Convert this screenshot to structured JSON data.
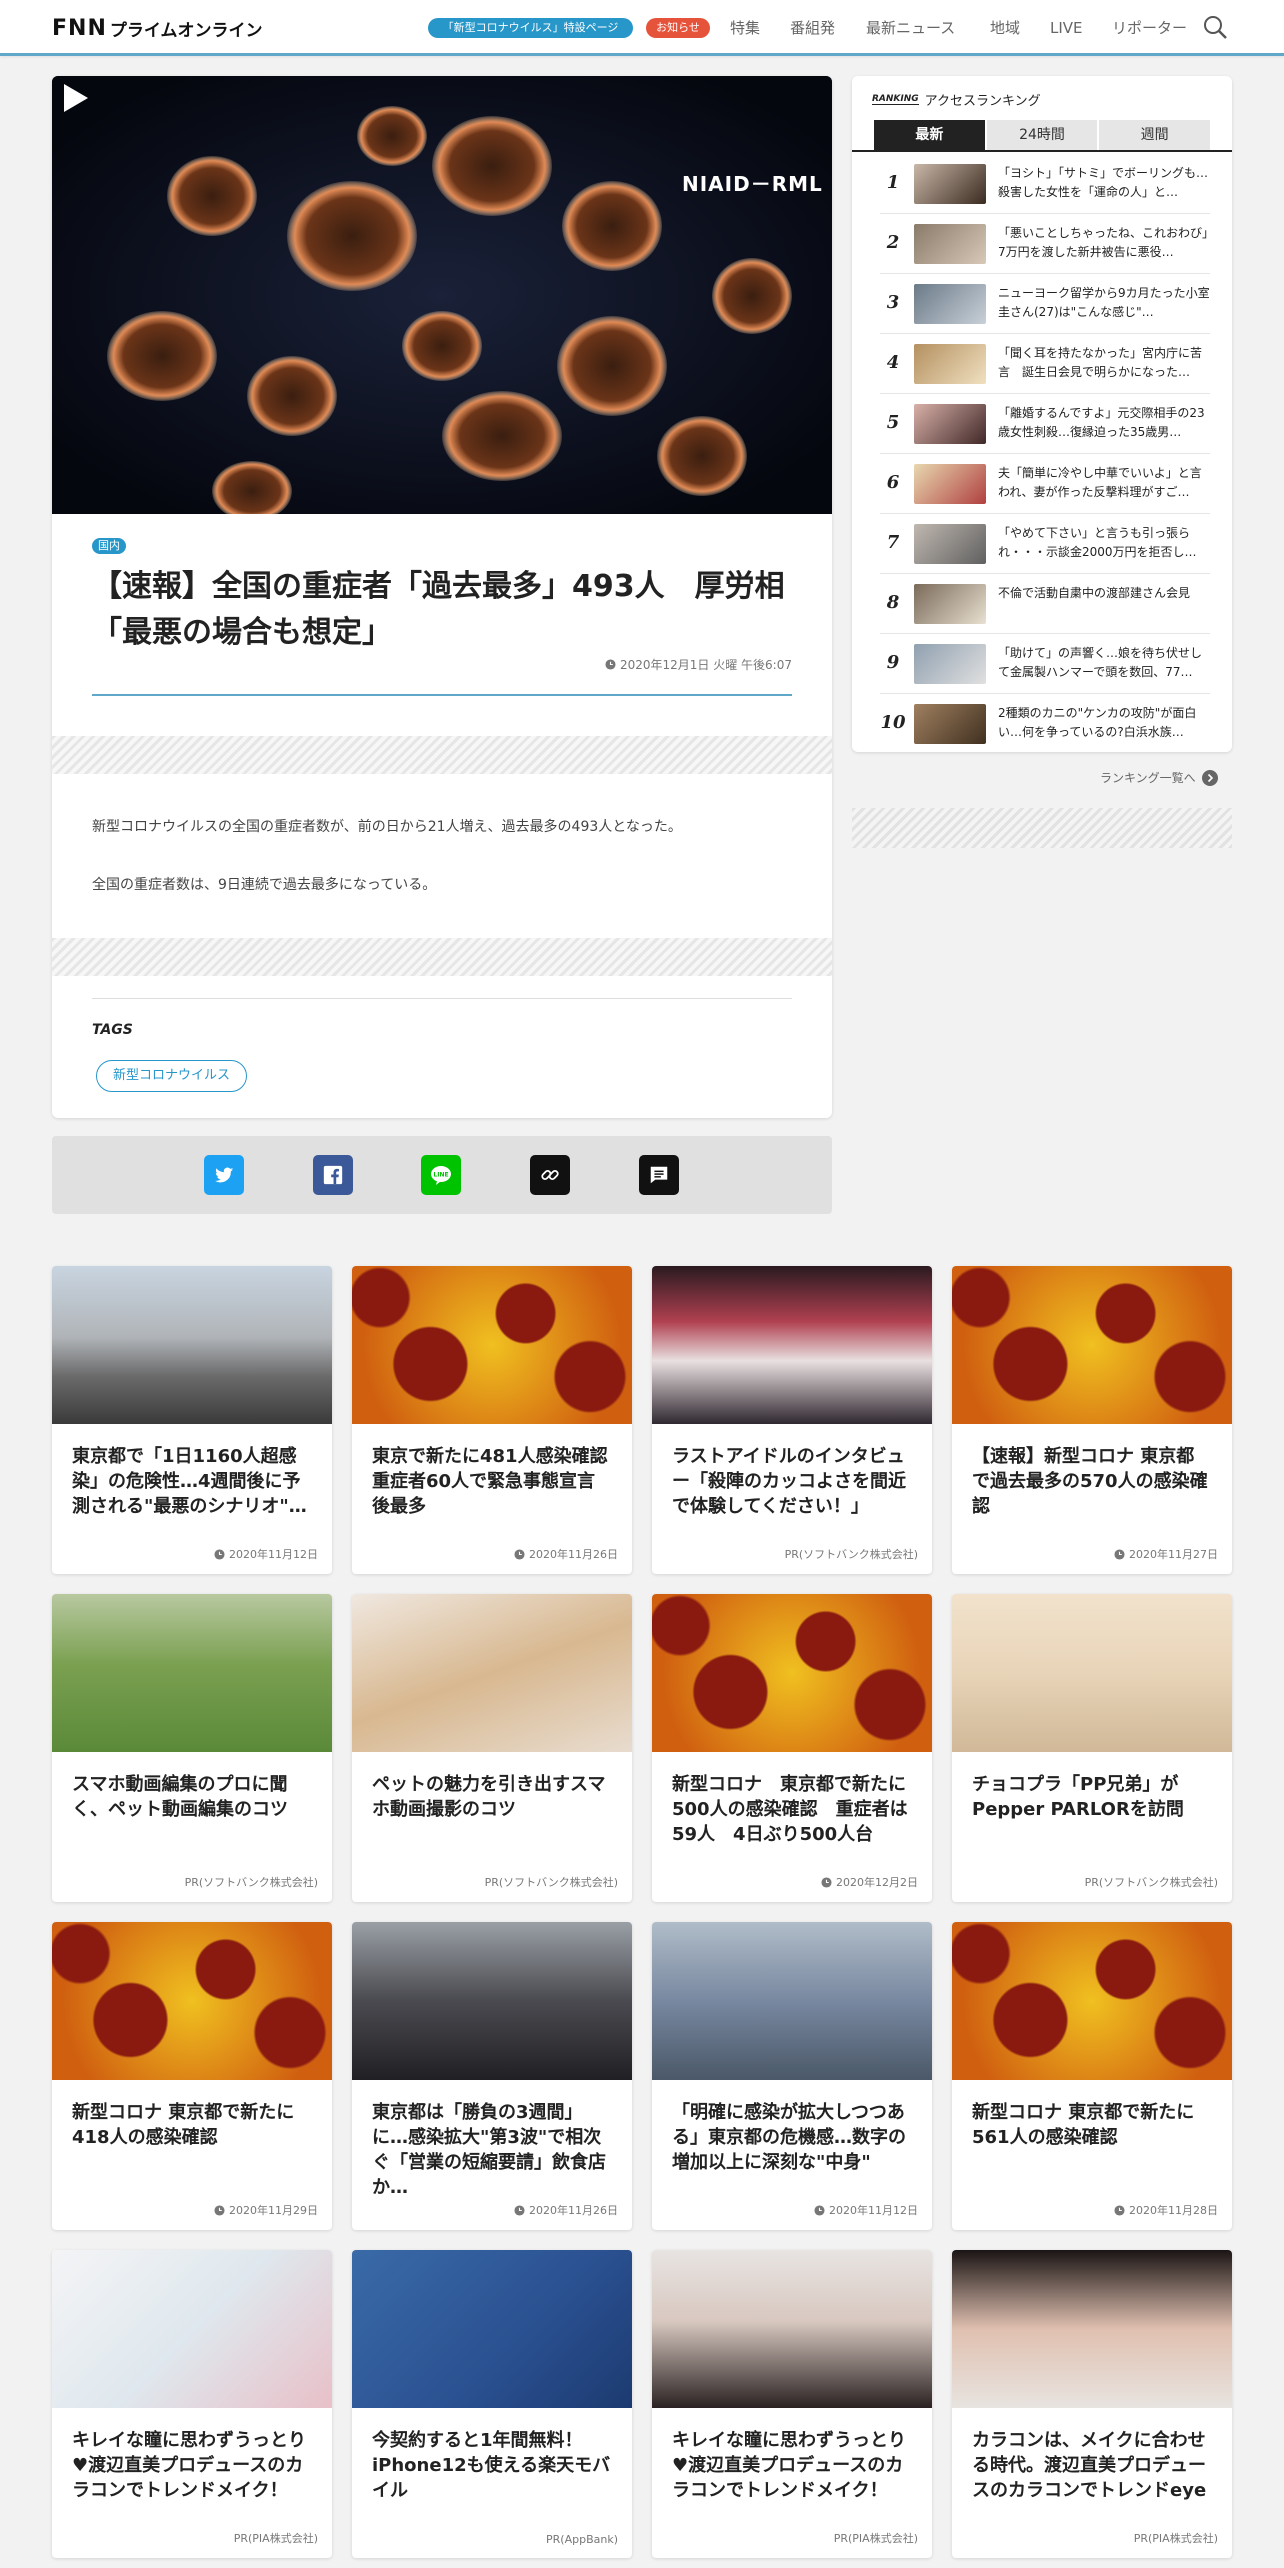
{
  "header": {
    "logo_fnn": "FNN",
    "logo_prime": "プライムオンライン",
    "corona_page": "「新型コロナウイルス」特設ページ",
    "notice": "お知らせ",
    "nav": [
      "特集",
      "番組発",
      "最新ニュース",
      "地域",
      "LIVE",
      "リポーター"
    ]
  },
  "article": {
    "hero_credit": "NIAID－RML",
    "category": "国内",
    "headline": "【速報】全国の重症者「過去最多」493人　厚労相「最悪の場合も想定」",
    "date": "2020年12月1日 火曜 午後6:07",
    "body": [
      "新型コロナウイルスの全国の重症者数が、前の日から21人増え、過去最多の493人となった。",
      "全国の重症者数は、9日連続で過去最多になっている。"
    ],
    "tags_label": "TAGS",
    "tags": [
      "新型コロナウイルス"
    ]
  },
  "share": [
    "twitter-icon",
    "facebook-icon",
    "line-icon",
    "link-icon",
    "comment-icon"
  ],
  "colors": {
    "accent": "#2796c9",
    "notice": "#e5533b",
    "twitter": "#1da1f2",
    "facebook": "#3b5998",
    "line": "#00c300"
  },
  "ranking": {
    "label_en": "RANKING",
    "label_jp": "アクセスランキング",
    "tabs": [
      "最新",
      "24時間",
      "週間"
    ],
    "active_tab": "最新",
    "items": [
      {
        "rank": "1",
        "text": "「ヨシト」「サトミ」でボーリングも…殺害した女性を「運命の人」と…"
      },
      {
        "rank": "2",
        "text": "「悪いことしちゃったね、これおわび」7万円を渡した新井被告に悪役…"
      },
      {
        "rank": "3",
        "text": "ニューヨーク留学から9カ月たった小室圭さん(27)は\"こんな感じ\"…"
      },
      {
        "rank": "4",
        "text": "「聞く耳を持たなかった」宮内庁に苦言　誕生日会見で明らかになった…"
      },
      {
        "rank": "5",
        "text": "「離婚するんですよ」元交際相手の23歳女性刺殺…復縁迫った35歳男…"
      },
      {
        "rank": "6",
        "text": "夫「簡単に冷やし中華でいいよ」と言われ、妻が作った反撃料理がすご…"
      },
      {
        "rank": "7",
        "text": "「やめて下さい」と言うも引っ張られ・・・示談金2000万円を拒否し…"
      },
      {
        "rank": "8",
        "text": "不倫で活動自粛中の渡部建さん会見"
      },
      {
        "rank": "9",
        "text": "「助けて」の声響く…娘を待ち伏せして金属製ハンマーで頭を数回、77…"
      },
      {
        "rank": "10",
        "text": "2種類のカニの\"ケンカの攻防\"が面白い…何を争っているの?白浜水族…"
      }
    ],
    "more": "ランキング一覧へ"
  },
  "cards": [
    {
      "title": "東京都で「1日1160人超感染」の危険性…4週間後に予測される\"最悪のシナリオ\"…",
      "meta": "2020年11月12日",
      "clock": true,
      "img": "street"
    },
    {
      "title": "東京で新たに481人感染確認　重症者60人で緊急事態宣言後最多",
      "meta": "2020年11月26日",
      "clock": true,
      "img": "virus"
    },
    {
      "title": "ラストアイドルのインタビュー「殺陣のカッコよさを間近で体験してください！」",
      "meta": "PR(ソフトバンク株式会社)",
      "clock": false,
      "img": "idol"
    },
    {
      "title": "【速報】新型コロナ 東京都で過去最多の570人の感染確認",
      "meta": "2020年11月27日",
      "clock": true,
      "img": "virus"
    },
    {
      "title": "スマホ動画編集のプロに聞く、ペット動画編集のコツ",
      "meta": "PR(ソフトバンク株式会社)",
      "clock": false,
      "img": "dogs"
    },
    {
      "title": "ペットの魅力を引き出すスマホ動画撮影のコツ",
      "meta": "PR(ソフトバンク株式会社)",
      "clock": false,
      "img": "dog"
    },
    {
      "title": "新型コロナ　東京都で新たに500人の感染確認　重症者は59人　4日ぶり500人台",
      "meta": "2020年12月2日",
      "clock": true,
      "img": "virus"
    },
    {
      "title": "チョコプラ「PP兄弟」がPepper PARLORを訪問",
      "meta": "PR(ソフトバンク株式会社)",
      "clock": false,
      "img": "pp"
    },
    {
      "title": "新型コロナ 東京都で新たに418人の感染確認",
      "meta": "2020年11月29日",
      "clock": true,
      "img": "virus"
    },
    {
      "title": "東京都は「勝負の3週間」に…感染拡大\"第3波\"で相次ぐ「営業の短縮要請」飲食店か…",
      "meta": "2020年11月26日",
      "clock": true,
      "img": "crowd"
    },
    {
      "title": "「明確に感染が拡大しつつある」東京都の危機感…数字の増加以上に深刻な\"中身\"",
      "meta": "2020年11月12日",
      "clock": true,
      "img": "city"
    },
    {
      "title": "新型コロナ 東京都で新たに561人の感染確認",
      "meta": "2020年11月28日",
      "clock": true,
      "img": "virus"
    },
    {
      "title": "キレイな瞳に思わずうっとり♥渡辺直美プロデュースのカラコンでトレンドメイク！",
      "meta": "PR(PIA株式会社)",
      "clock": false,
      "img": "lens"
    },
    {
      "title": "今契約すると1年間無料！iPhone12も使える楽天モバイル",
      "meta": "PR(AppBank)",
      "clock": false,
      "img": "phone"
    },
    {
      "title": "キレイな瞳に思わずうっとり♥渡辺直美プロデュースのカラコンでトレンドメイク！",
      "meta": "PR(PIA株式会社)",
      "clock": false,
      "img": "woman1"
    },
    {
      "title": "カラコンは、メイクに合わせる時代。渡辺直美プロデュースのカラコンでトレンドeye",
      "meta": "PR(PIA株式会社)",
      "clock": false,
      "img": "woman2"
    }
  ]
}
